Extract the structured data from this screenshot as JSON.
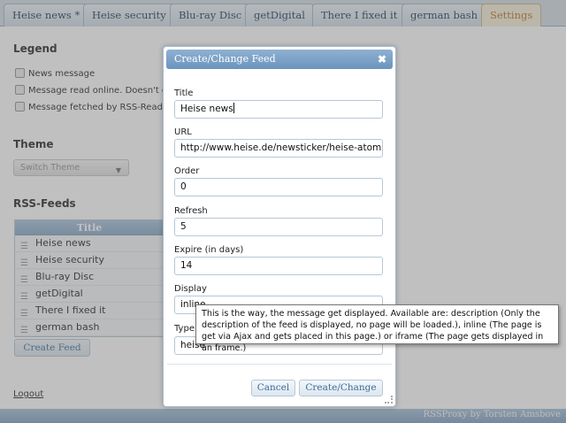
{
  "tabs": [
    {
      "label": "Heise news *",
      "active": false
    },
    {
      "label": "Heise security",
      "active": false
    },
    {
      "label": "Blu-ray Disc",
      "active": false
    },
    {
      "label": "getDigital",
      "active": false
    },
    {
      "label": "There I fixed it",
      "active": false
    },
    {
      "label": "german bash",
      "active": false
    },
    {
      "label": "Settings",
      "active": true
    }
  ],
  "legend": {
    "heading": "Legend",
    "items": [
      {
        "icon": "news-message-icon",
        "label": "News message"
      },
      {
        "icon": "read-online-icon",
        "label": "Message read online. Doesn't g"
      },
      {
        "icon": "fetched-icon",
        "label": "Message fetched by RSS-Reade"
      }
    ]
  },
  "theme": {
    "heading": "Theme",
    "select_value": "Switch Theme"
  },
  "feeds": {
    "heading": "RSS-Feeds",
    "column_title": "Title",
    "rows": [
      "Heise news",
      "Heise security",
      "Blu-ray Disc",
      "getDigital",
      "There I fixed it",
      "german bash"
    ],
    "create_button": "Create Feed"
  },
  "logout": "Logout",
  "footer": "RSSProxy by Torsten Amsbove",
  "dialog": {
    "title": "Create/Change Feed",
    "close": "✖",
    "fields": {
      "title": {
        "label": "Title",
        "value": "Heise news"
      },
      "url": {
        "label": "URL",
        "value": "http://www.heise.de/newsticker/heise-atom.xr"
      },
      "order": {
        "label": "Order",
        "value": "0"
      },
      "refresh": {
        "label": "Refresh",
        "value": "5"
      },
      "expire": {
        "label": "Expire (in days)",
        "value": "14"
      },
      "display": {
        "label": "Display",
        "value": "inline"
      },
      "type": {
        "label": "Type",
        "value": "heise"
      }
    },
    "cancel": "Cancel",
    "submit": "Create/Change"
  },
  "tooltip": "This is the way, the message get displayed. Available are: description (Only the description of the feed is displayed, no page will be loaded.), inline (The page is get via Ajax and gets placed in this page.) or iframe (The page gets displayed in an frame.)",
  "colors": {
    "tab_active": "#c47a2c",
    "accent": "#6b94bd",
    "link": "#3d6c9c"
  }
}
